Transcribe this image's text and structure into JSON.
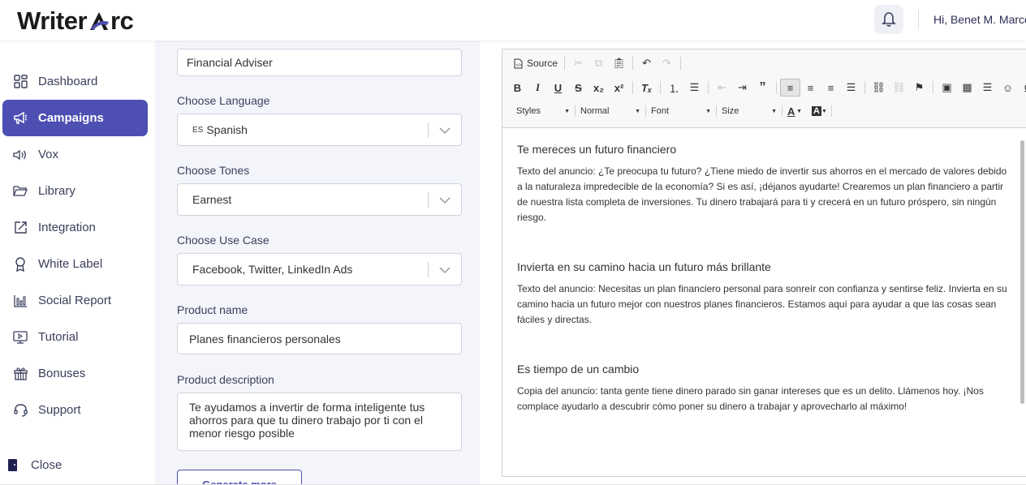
{
  "app": {
    "logo_text_left": "Writer",
    "logo_text_right": "rc",
    "brand_color": "#4d4fb2",
    "greeting": "Hi, Benet M. Marco"
  },
  "sidebar": {
    "items": [
      {
        "label": "Dashboard",
        "icon": "dashboard-grid-icon"
      },
      {
        "label": "Campaigns",
        "icon": "megaphone-icon",
        "active": true
      },
      {
        "label": "Vox",
        "icon": "speaker-icon"
      },
      {
        "label": "Library",
        "icon": "folder-icon"
      },
      {
        "label": "Integration",
        "icon": "external-link-icon"
      },
      {
        "label": "White Label",
        "icon": "award-icon"
      },
      {
        "label": "Social Report",
        "icon": "bar-chart-icon"
      },
      {
        "label": "Tutorial",
        "icon": "monitor-icon"
      },
      {
        "label": "Bonuses",
        "icon": "gift-icon"
      },
      {
        "label": "Support",
        "icon": "headset-icon"
      }
    ],
    "close_label": "Close"
  },
  "form": {
    "top_input_value": "Financial Adviser",
    "language_label": "Choose Language",
    "language_code": "ES",
    "language_value": "Spanish",
    "tones_label": "Choose Tones",
    "tones_value": "Earnest",
    "use_case_label": "Choose Use Case",
    "use_case_value": "Facebook, Twitter, LinkedIn Ads",
    "product_name_label": "Product name",
    "product_name_value": "Planes financieros personales",
    "product_description_label": "Product description",
    "product_description_value": "Te ayudamos a invertir de forma inteligente tus ahorros para que tu dinero trabajo por ti con el menor riesgo posible",
    "generate_button": "Generate more"
  },
  "editor": {
    "source_label": "Source",
    "styles_label": "Styles",
    "format_label": "Normal",
    "font_label": "Font",
    "size_label": "Size",
    "ads": [
      {
        "headline": "Te mereces un futuro financiero",
        "body": "Texto del anuncio: ¿Te preocupa tu futuro? ¿Tiene miedo de invertir sus ahorros en el mercado de valores debido a la naturaleza impredecible de la economía? Si es así, ¡déjanos ayudarte! Crearemos un plan financiero a partir de nuestra lista completa de inversiones. Tu dinero trabajará para ti y crecerá en un futuro próspero, sin ningún riesgo."
      },
      {
        "headline": "Invierta en su camino hacia un futuro más brillante",
        "body": "Texto del anuncio: Necesitas un plan financiero personal para sonreír con confianza y sentirse feliz. Invierta en su camino hacia un futuro mejor con nuestros planes financieros. Estamos aquí para ayudar a que las cosas sean fáciles y directas."
      },
      {
        "headline": "Es tiempo de un cambio",
        "body": "Copia del anuncio: tanta gente tiene dinero parado sin ganar intereses que es un delito. Llámenos hoy. ¡Nos complace ayudarlo a descubrir cómo poner su dinero a trabajar y aprovecharlo al máximo!"
      }
    ]
  }
}
